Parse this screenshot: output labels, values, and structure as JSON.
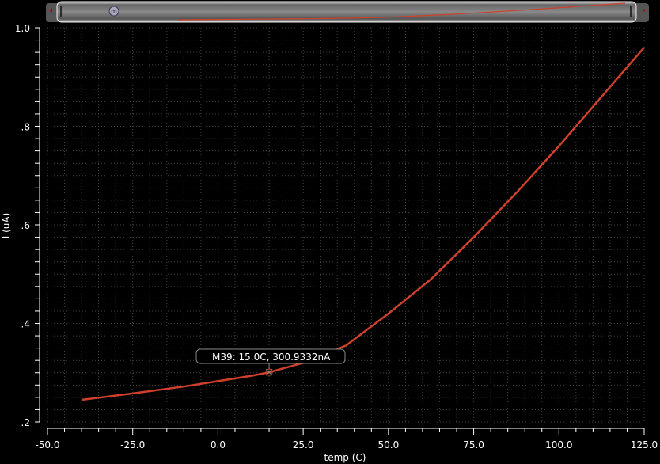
{
  "chart_data": {
    "type": "line",
    "title": "",
    "xlabel": "temp (C)",
    "ylabel": "I (uA)",
    "xlim": [
      -50,
      125
    ],
    "ylim": [
      0.2,
      1.0
    ],
    "grid": true,
    "x_ticks": [
      -50,
      -25,
      0,
      25,
      50,
      75,
      100,
      125
    ],
    "x_tick_labels": [
      "-50.0",
      "-25.0",
      "0.0",
      "25.0",
      "50.0",
      "75.0",
      "100.0",
      "125.0"
    ],
    "y_ticks": [
      0.2,
      0.4,
      0.6,
      0.8,
      1.0
    ],
    "y_tick_labels": [
      ".2",
      ".4",
      ".6",
      ".8",
      "1.0"
    ],
    "series": [
      {
        "name": "I",
        "color": "#d0402a",
        "x": [
          -40,
          -25,
          -10,
          0,
          10,
          15,
          25,
          37.5,
          50,
          62.5,
          75,
          87.5,
          100,
          112.5,
          125
        ],
        "y": [
          0.245,
          0.258,
          0.272,
          0.283,
          0.294,
          0.301,
          0.32,
          0.355,
          0.42,
          0.49,
          0.575,
          0.665,
          0.76,
          0.86,
          0.96
        ]
      }
    ],
    "marker": {
      "label": "M39: 15.0C, 300.9332nA",
      "x": 15.0,
      "y": 0.3009332
    }
  }
}
